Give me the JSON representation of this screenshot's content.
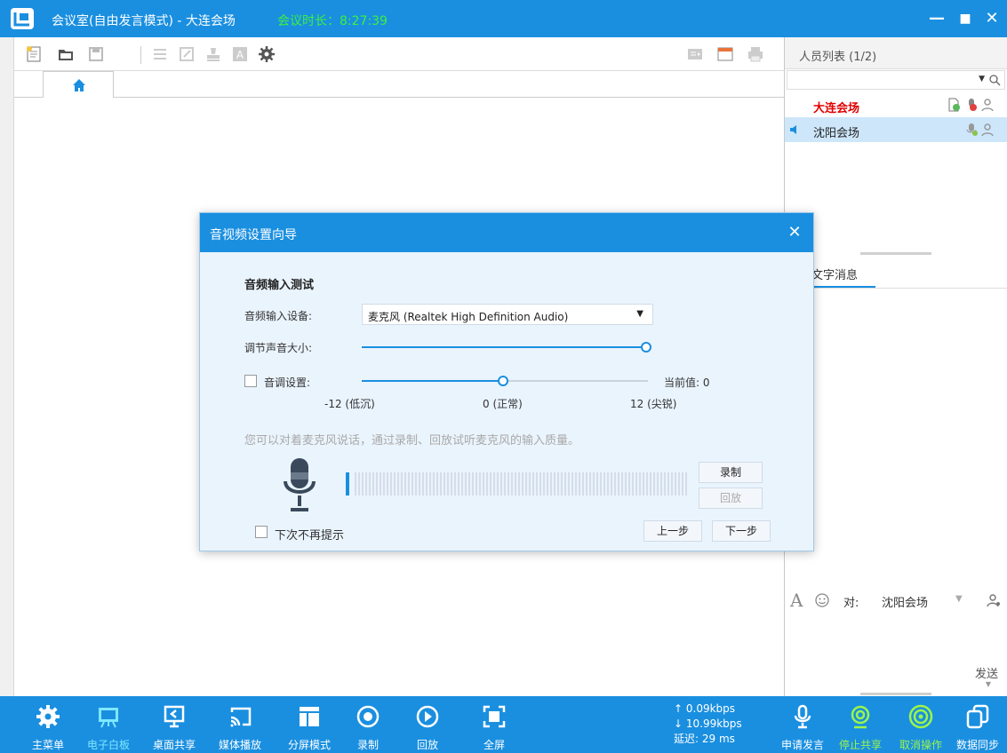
{
  "titlebar": {
    "title": "会议室(自由发言模式) - 大连会场",
    "duration": "会议时长：8:27:39",
    "minimize": "—",
    "maximize": "■",
    "close": "✕"
  },
  "toolbar": {
    "icons": [
      "new-icon",
      "open-folder-icon",
      "save-icon",
      "list-icon",
      "edit-icon",
      "stamp-icon",
      "text-icon",
      "gear-icon",
      "slideshow-icon",
      "window-icon",
      "print-icon"
    ]
  },
  "tabs": {
    "home_icon": "home-icon"
  },
  "participants": {
    "header": "人员列表 (1/2)",
    "search_placeholder": "",
    "items": [
      {
        "name": "大连会场",
        "color": "#e00000"
      },
      {
        "name": "沈阳会场",
        "color": "#222222"
      }
    ]
  },
  "messages": {
    "tab_label": "文字消息",
    "to_label": "对:",
    "recipient": "沈阳会场",
    "send_label": "发送"
  },
  "dialog": {
    "title": "音视频设置向导",
    "section": "音频输入测试",
    "device_label": "音频输入设备:",
    "device_value": "麦克风 (Realtek High Definition Audio)",
    "volume_label": "调节声音大小:",
    "volume_level": 1.0,
    "pitch_label": "音调设置:",
    "pitch_current": "当前值: 0",
    "pitch_value": 0,
    "pitch_min_label": "-12 (低沉)",
    "pitch_mid_label": "0 (正常)",
    "pitch_max_label": "12 (尖锐)",
    "hint": "您可以对着麦克风说话，通过录制、回放试听麦克风的输入质量。",
    "record_button": "录制",
    "playback_button": "回放",
    "no_prompt_label": "下次不再提示",
    "prev_button": "上一步",
    "next_button": "下一步"
  },
  "bottombar": {
    "items": [
      {
        "label": "主菜单",
        "icon": "gear-icon"
      },
      {
        "label": "电子白板",
        "icon": "whiteboard-icon"
      },
      {
        "label": "桌面共享",
        "icon": "desktop-share-icon"
      },
      {
        "label": "媒体播放",
        "icon": "cast-icon"
      },
      {
        "label": "分屏模式",
        "icon": "split-screen-icon"
      },
      {
        "label": "录制",
        "icon": "record-icon"
      },
      {
        "label": "回放",
        "icon": "play-icon"
      },
      {
        "label": "全屏",
        "icon": "fullscreen-icon"
      }
    ],
    "upload": "↑ 0.09kbps",
    "download": "↓ 10.99kbps",
    "latency": "延迟: 29 ms",
    "right_items": [
      {
        "label": "申请发言",
        "icon": "microphone-icon"
      },
      {
        "label": "停止共享",
        "icon": "webcam-icon"
      },
      {
        "label": "取消操作",
        "icon": "cancel-ring-icon"
      },
      {
        "label": "数据同步",
        "icon": "sync-icon"
      }
    ]
  },
  "colors": {
    "accent": "#1a8fe0",
    "duration": "#3df03d",
    "active_label": "#7ee8ff",
    "green_label": "#9cf54a"
  }
}
